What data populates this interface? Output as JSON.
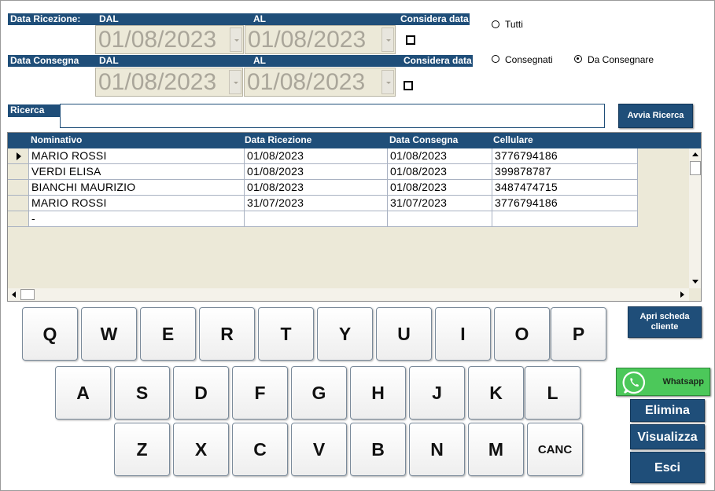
{
  "data_ricezione": {
    "label": "Data Ricezione:",
    "dal_label": "DAL",
    "al_label": "AL",
    "considera_label": "Considera data",
    "dal_value": "01/08/2023",
    "al_value": "01/08/2023"
  },
  "data_consegna": {
    "label": "Data Consegna",
    "dal_label": "DAL",
    "al_label": "AL",
    "considera_label": "Considera data",
    "dal_value": "01/08/2023",
    "al_value": "01/08/2023"
  },
  "filters": {
    "tutti": "Tutti",
    "consegnati": "Consegnati",
    "da_consegnare": "Da Consegnare",
    "selected": "da_consegnare"
  },
  "search": {
    "label": "Ricerca",
    "value": "",
    "button": "Avvia Ricerca"
  },
  "table": {
    "columns": [
      "Nominativo",
      "Data Ricezione",
      "Data Consegna",
      "Cellulare"
    ],
    "rows": [
      [
        "MARIO ROSSI",
        "01/08/2023",
        "01/08/2023",
        "3776794186"
      ],
      [
        "VERDI ELISA",
        "01/08/2023",
        "01/08/2023",
        "399878787"
      ],
      [
        "BIANCHI MAURIZIO",
        "01/08/2023",
        "01/08/2023",
        "3487474715"
      ],
      [
        "MARIO ROSSI",
        "31/07/2023",
        "31/07/2023",
        "3776794186"
      ],
      [
        "-",
        "",
        "",
        ""
      ]
    ]
  },
  "keyboard": {
    "row1": [
      "Q",
      "W",
      "E",
      "R",
      "T",
      "Y",
      "U",
      "I",
      "O",
      "P"
    ],
    "row2": [
      "A",
      "S",
      "D",
      "F",
      "G",
      "H",
      "J",
      "K",
      "L"
    ],
    "row3": [
      "Z",
      "X",
      "C",
      "V",
      "B",
      "N",
      "M",
      "CANC"
    ]
  },
  "actions": {
    "apri_scheda": "Apri scheda cliente",
    "whatsapp": "Whatsapp",
    "elimina": "Elimina",
    "visualizza": "Visualizza",
    "esci": "Esci"
  },
  "colors": {
    "header_blue": "#1f4e79",
    "whatsapp_green": "#4cc85a"
  }
}
